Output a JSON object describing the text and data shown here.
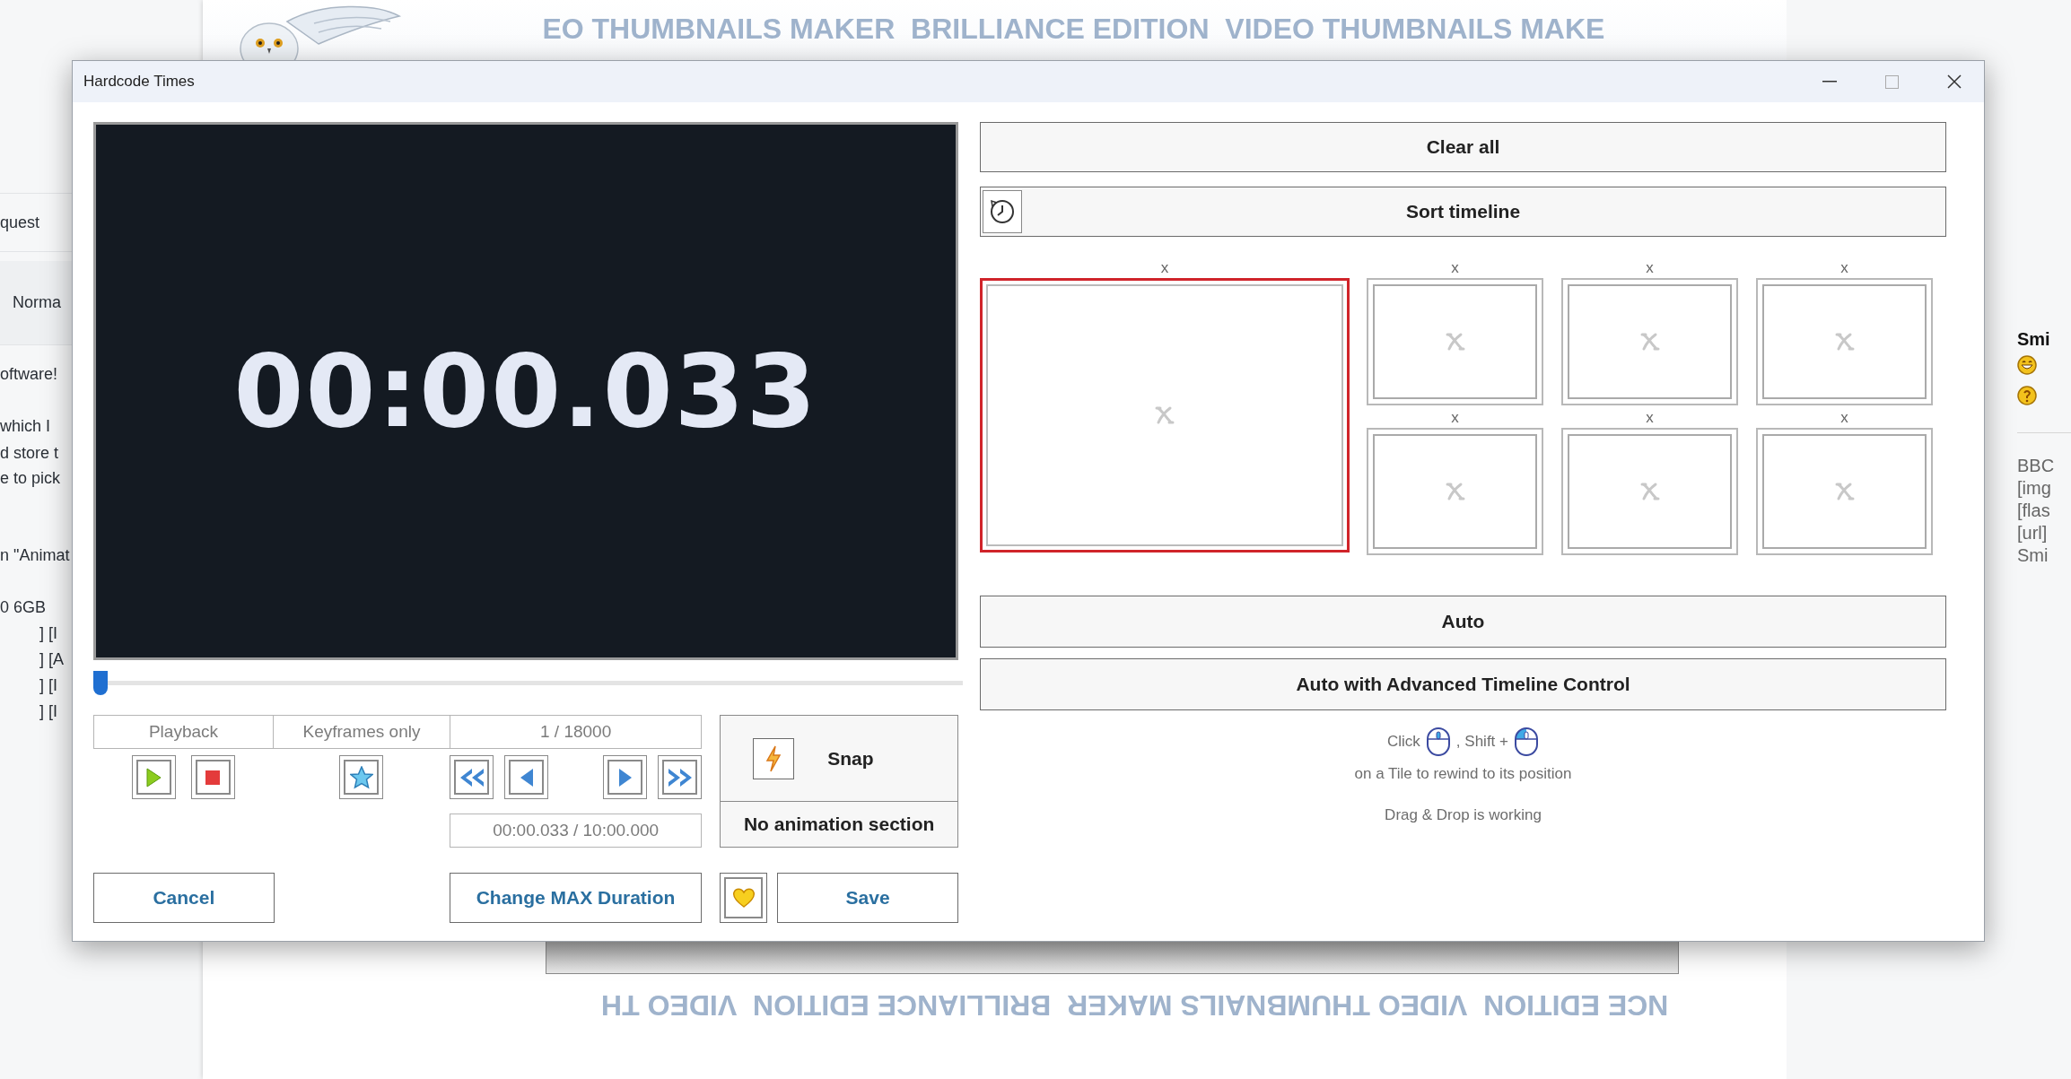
{
  "background_page": {
    "banner_text": "EO THUMBNAILS MAKER  BRILLIANCE EDITION  VIDEO THUMBNAILS MAKE",
    "left_form_rows": [
      "quest",
      "Norma"
    ],
    "left_post_lines": [
      "oftware!",
      "which I",
      "d store t",
      "e to pick",
      "n \"Animat",
      "0 6GB"
    ],
    "left_code_lines": [
      "] [I",
      "] [A",
      "] [I",
      "] [I"
    ],
    "right_heading": "Smi",
    "right_lines": [
      "BBC",
      "[img",
      "[flas",
      "[url]",
      "Smi"
    ],
    "footer_text": "NCE EDITION  VIDEO THUMBNAILS MAKER  BRILLIANCE EDITION  VIDEO TH"
  },
  "window": {
    "title": "Hardcode Times"
  },
  "preview": {
    "time": "00:00.033"
  },
  "timeline_slider": {
    "level": 0
  },
  "playback": {
    "headers": [
      "Playback",
      "Keyframes only",
      "1 / 18000"
    ],
    "time_display": "00:00.033 / 10:00.000"
  },
  "snap": {
    "label": "Snap",
    "section": "No animation section"
  },
  "buttons": {
    "cancel": "Cancel",
    "change_max": "Change MAX Duration",
    "save": "Save"
  },
  "right_panel": {
    "clear_all": "Clear all",
    "sort_timeline": "Sort timeline",
    "tiles": [
      {
        "close": "x",
        "selected": true
      },
      {
        "close": "x",
        "selected": false
      },
      {
        "close": "x",
        "selected": false
      },
      {
        "close": "x",
        "selected": false
      },
      {
        "close": "x",
        "selected": false
      },
      {
        "close": "x",
        "selected": false
      },
      {
        "close": "x",
        "selected": false
      }
    ],
    "auto": "Auto",
    "auto_advanced": "Auto with Advanced Timeline Control",
    "hint_click": "Click",
    "hint_shift": ", Shift +",
    "hint_tile": "on a Tile to rewind to its position",
    "hint_drag": "Drag & Drop is working"
  }
}
